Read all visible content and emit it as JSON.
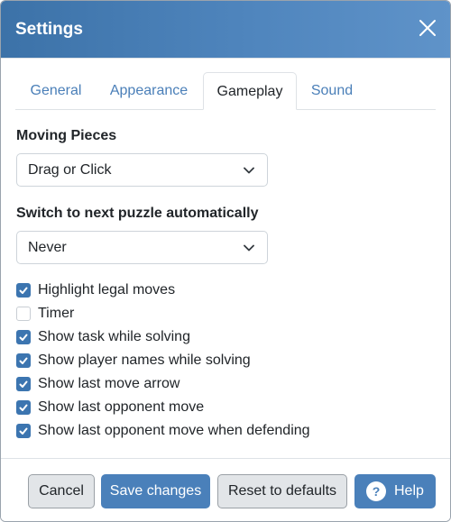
{
  "dialog": {
    "title": "Settings",
    "close_icon": "close-icon"
  },
  "tabs": [
    {
      "label": "General",
      "active": false
    },
    {
      "label": "Appearance",
      "active": false
    },
    {
      "label": "Gameplay",
      "active": true
    },
    {
      "label": "Sound",
      "active": false
    }
  ],
  "gameplay": {
    "moving_pieces": {
      "label": "Moving Pieces",
      "value": "Drag or Click"
    },
    "next_puzzle": {
      "label": "Switch to next puzzle automatically",
      "value": "Never"
    },
    "options": [
      {
        "label": "Highlight legal moves",
        "checked": true
      },
      {
        "label": "Timer",
        "checked": false
      },
      {
        "label": "Show task while solving",
        "checked": true
      },
      {
        "label": "Show player names while solving",
        "checked": true
      },
      {
        "label": "Show last move arrow",
        "checked": true
      },
      {
        "label": "Show last opponent move",
        "checked": true
      },
      {
        "label": "Show last opponent move when defending",
        "checked": true
      }
    ]
  },
  "footer": {
    "cancel_label": "Cancel",
    "save_label": "Save changes",
    "reset_label": "Reset to defaults",
    "help_label": "Help",
    "help_icon_glyph": "?"
  },
  "colors": {
    "header_gradient_start": "#3c72a8",
    "header_gradient_end": "#5f93c9",
    "accent": "#4a80ba",
    "checkbox_checked": "#3c75b0",
    "tab_link": "#4a7fb8"
  }
}
